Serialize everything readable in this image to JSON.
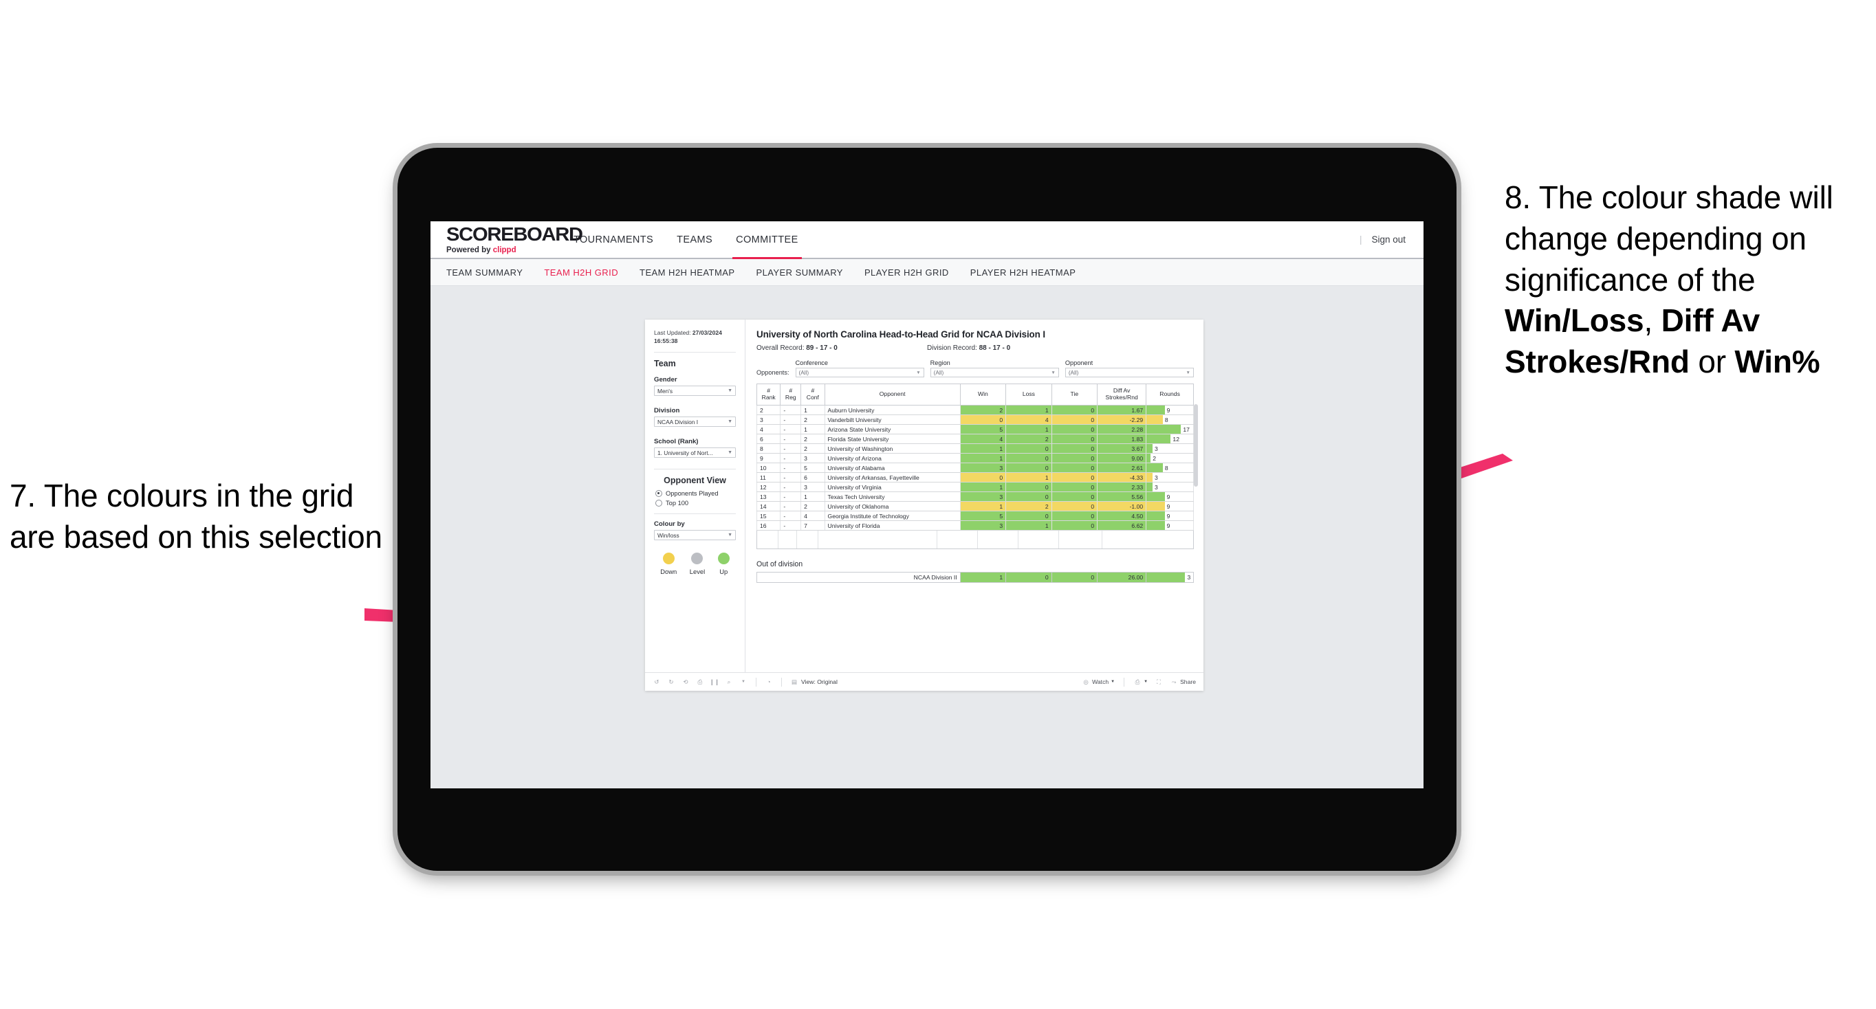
{
  "annotations": {
    "left": {
      "number": "7.",
      "text": "7. The colours in the grid are based on this selection"
    },
    "right": {
      "line1": "8. The colour shade will change depending on significance of the ",
      "bold1": "Win/Loss",
      "mid1": ", ",
      "bold2": "Diff Av Strokes/Rnd",
      "mid2": " or ",
      "bold3": "Win%"
    },
    "arrow_color": "#f0306b"
  },
  "app": {
    "brand": {
      "title": "SCOREBOARD",
      "powered_prefix": "Powered by ",
      "powered_brand": "clippd"
    },
    "topnav": [
      {
        "label": "TOURNAMENTS",
        "active": false
      },
      {
        "label": "TEAMS",
        "active": false
      },
      {
        "label": "COMMITTEE",
        "active": true
      }
    ],
    "signout": {
      "divider": "|",
      "label": "Sign out"
    },
    "subnav": [
      {
        "label": "TEAM SUMMARY",
        "active": false
      },
      {
        "label": "TEAM H2H GRID",
        "active": true
      },
      {
        "label": "TEAM H2H HEATMAP",
        "active": false
      },
      {
        "label": "PLAYER SUMMARY",
        "active": false
      },
      {
        "label": "PLAYER H2H GRID",
        "active": false
      },
      {
        "label": "PLAYER H2H HEATMAP",
        "active": false
      }
    ]
  },
  "filters": {
    "last_updated_prefix": "Last Updated: ",
    "last_updated_value": "27/03/2024 16:55:38",
    "team_heading": "Team",
    "gender_label": "Gender",
    "gender_value": "Men's",
    "division_label": "Division",
    "division_value": "NCAA Division I",
    "school_label": "School (Rank)",
    "school_value": "1. University of Nort...",
    "opponent_view_heading": "Opponent View",
    "opponent_view_options": [
      {
        "label": "Opponents Played",
        "selected": true
      },
      {
        "label": "Top 100",
        "selected": false
      }
    ],
    "colour_by_label": "Colour by",
    "colour_by_value": "Win/loss",
    "legend": [
      {
        "label": "Down",
        "color": "#f2d04e"
      },
      {
        "label": "Level",
        "color": "#bcbec3"
      },
      {
        "label": "Up",
        "color": "#8ed16a"
      }
    ]
  },
  "viz": {
    "title": "University of North Carolina Head-to-Head Grid for NCAA Division I",
    "overall_record_label": "Overall Record: ",
    "overall_record_value": "89 - 17 - 0",
    "division_record_label": "Division Record: ",
    "division_record_value": "88 - 17 - 0",
    "opponents_label": "Opponents:",
    "opponent_filters": [
      {
        "label": "Conference",
        "value": "(All)"
      },
      {
        "label": "Region",
        "value": "(All)"
      },
      {
        "label": "Opponent",
        "value": "(All)"
      }
    ],
    "columns": [
      {
        "l1": "#",
        "l2": "Rank"
      },
      {
        "l1": "#",
        "l2": "Reg"
      },
      {
        "l1": "#",
        "l2": "Conf"
      },
      {
        "l1": "",
        "l2": "Opponent"
      },
      {
        "l1": "",
        "l2": "Win"
      },
      {
        "l1": "",
        "l2": "Loss"
      },
      {
        "l1": "",
        "l2": "Tie"
      },
      {
        "l1": "Diff Av",
        "l2": "Strokes/Rnd"
      },
      {
        "l1": "",
        "l2": "Rounds"
      }
    ],
    "rows": [
      {
        "rank": "2",
        "reg": "-",
        "conf": "1",
        "opponent": "Auburn University",
        "win": "2",
        "loss": "1",
        "tie": "0",
        "diff": "1.67",
        "rounds": "9",
        "state": "up"
      },
      {
        "rank": "3",
        "reg": "-",
        "conf": "2",
        "opponent": "Vanderbilt University",
        "win": "0",
        "loss": "4",
        "tie": "0",
        "diff": "-2.29",
        "rounds": "8",
        "state": "down"
      },
      {
        "rank": "4",
        "reg": "-",
        "conf": "1",
        "opponent": "Arizona State University",
        "win": "5",
        "loss": "1",
        "tie": "0",
        "diff": "2.28",
        "rounds": "17",
        "state": "up"
      },
      {
        "rank": "6",
        "reg": "-",
        "conf": "2",
        "opponent": "Florida State University",
        "win": "4",
        "loss": "2",
        "tie": "0",
        "diff": "1.83",
        "rounds": "12",
        "state": "up"
      },
      {
        "rank": "8",
        "reg": "-",
        "conf": "2",
        "opponent": "University of Washington",
        "win": "1",
        "loss": "0",
        "tie": "0",
        "diff": "3.67",
        "rounds": "3",
        "state": "up"
      },
      {
        "rank": "9",
        "reg": "-",
        "conf": "3",
        "opponent": "University of Arizona",
        "win": "1",
        "loss": "0",
        "tie": "0",
        "diff": "9.00",
        "rounds": "2",
        "state": "up"
      },
      {
        "rank": "10",
        "reg": "-",
        "conf": "5",
        "opponent": "University of Alabama",
        "win": "3",
        "loss": "0",
        "tie": "0",
        "diff": "2.61",
        "rounds": "8",
        "state": "up"
      },
      {
        "rank": "11",
        "reg": "-",
        "conf": "6",
        "opponent": "University of Arkansas, Fayetteville",
        "win": "0",
        "loss": "1",
        "tie": "0",
        "diff": "-4.33",
        "rounds": "3",
        "state": "down"
      },
      {
        "rank": "12",
        "reg": "-",
        "conf": "3",
        "opponent": "University of Virginia",
        "win": "1",
        "loss": "0",
        "tie": "0",
        "diff": "2.33",
        "rounds": "3",
        "state": "up"
      },
      {
        "rank": "13",
        "reg": "-",
        "conf": "1",
        "opponent": "Texas Tech University",
        "win": "3",
        "loss": "0",
        "tie": "0",
        "diff": "5.56",
        "rounds": "9",
        "state": "up"
      },
      {
        "rank": "14",
        "reg": "-",
        "conf": "2",
        "opponent": "University of Oklahoma",
        "win": "1",
        "loss": "2",
        "tie": "0",
        "diff": "-1.00",
        "rounds": "9",
        "state": "down"
      },
      {
        "rank": "15",
        "reg": "-",
        "conf": "4",
        "opponent": "Georgia Institute of Technology",
        "win": "5",
        "loss": "0",
        "tie": "0",
        "diff": "4.50",
        "rounds": "9",
        "state": "up"
      },
      {
        "rank": "16",
        "reg": "-",
        "conf": "7",
        "opponent": "University of Florida",
        "win": "3",
        "loss": "1",
        "tie": "0",
        "diff": "6.62",
        "rounds": "9",
        "state": "up"
      }
    ],
    "out_of_division": {
      "title": "Out of division",
      "row": {
        "label": "NCAA Division II",
        "win": "1",
        "loss": "0",
        "tie": "0",
        "diff": "26.00",
        "rounds": "3",
        "state": "up"
      }
    },
    "colors": {
      "up": "#8ed16a",
      "down": "#f3d863",
      "level": "#bcbec3"
    }
  },
  "toolbar": {
    "view_label": "View: Original",
    "watch_label": "Watch",
    "share_label": "Share"
  },
  "chart_data": {
    "type": "table",
    "title": "University of North Carolina Head-to-Head Grid for NCAA Division I",
    "columns": [
      "# Rank",
      "# Reg",
      "# Conf",
      "Opponent",
      "Win",
      "Loss",
      "Tie",
      "Diff Av Strokes/Rnd",
      "Rounds"
    ],
    "rows": [
      [
        "2",
        "-",
        "1",
        "Auburn University",
        2,
        1,
        0,
        1.67,
        9
      ],
      [
        "3",
        "-",
        "2",
        "Vanderbilt University",
        0,
        4,
        0,
        -2.29,
        8
      ],
      [
        "4",
        "-",
        "1",
        "Arizona State University",
        5,
        1,
        0,
        2.28,
        17
      ],
      [
        "6",
        "-",
        "2",
        "Florida State University",
        4,
        2,
        0,
        1.83,
        12
      ],
      [
        "8",
        "-",
        "2",
        "University of Washington",
        1,
        0,
        0,
        3.67,
        3
      ],
      [
        "9",
        "-",
        "3",
        "University of Arizona",
        1,
        0,
        0,
        9.0,
        2
      ],
      [
        "10",
        "-",
        "5",
        "University of Alabama",
        3,
        0,
        0,
        2.61,
        8
      ],
      [
        "11",
        "-",
        "6",
        "University of Arkansas, Fayetteville",
        0,
        1,
        0,
        -4.33,
        3
      ],
      [
        "12",
        "-",
        "3",
        "University of Virginia",
        1,
        0,
        0,
        2.33,
        3
      ],
      [
        "13",
        "-",
        "1",
        "Texas Tech University",
        3,
        0,
        0,
        5.56,
        9
      ],
      [
        "14",
        "-",
        "2",
        "University of Oklahoma",
        1,
        2,
        0,
        -1.0,
        9
      ],
      [
        "15",
        "-",
        "4",
        "Georgia Institute of Technology",
        5,
        0,
        0,
        4.5,
        9
      ],
      [
        "16",
        "-",
        "7",
        "University of Florida",
        3,
        1,
        0,
        6.62,
        9
      ]
    ],
    "out_of_division": [
      [
        "NCAA Division II",
        1,
        0,
        0,
        26.0,
        3
      ]
    ],
    "encoding": "cell background colour encodes Win/loss: green = up (net win), yellow = down (net loss); Rounds column shows a proportional bar"
  }
}
